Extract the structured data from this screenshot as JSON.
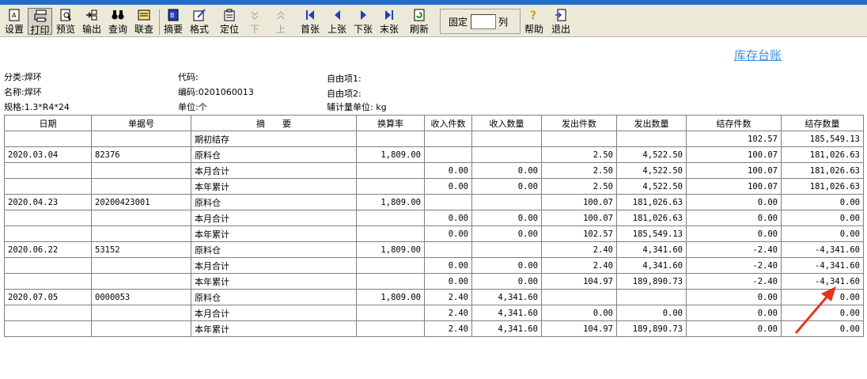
{
  "toolbar": {
    "buttons": [
      {
        "label": "设置",
        "icon": "settings-icon"
      },
      {
        "label": "打印",
        "icon": "printer-icon"
      },
      {
        "label": "预览",
        "icon": "preview-icon"
      },
      {
        "label": "输出",
        "icon": "export-icon"
      },
      {
        "label": "查询",
        "icon": "binoculars-icon"
      },
      {
        "label": "联查",
        "icon": "linked-query-icon"
      },
      {
        "label": "摘要",
        "icon": "summary-icon"
      },
      {
        "label": "格式",
        "icon": "format-icon"
      },
      {
        "label": "定位",
        "icon": "locate-icon"
      },
      {
        "label": "下",
        "icon": "down-icon"
      },
      {
        "label": "上",
        "icon": "up-icon"
      },
      {
        "label": "首张",
        "icon": "first-page-icon"
      },
      {
        "label": "上张",
        "icon": "prev-page-icon"
      },
      {
        "label": "下张",
        "icon": "next-page-icon"
      },
      {
        "label": "末张",
        "icon": "last-page-icon"
      },
      {
        "label": "刷新",
        "icon": "refresh-icon"
      },
      {
        "label": "帮助",
        "icon": "help-icon"
      },
      {
        "label": "退出",
        "icon": "exit-icon"
      }
    ],
    "fix_label": "固定",
    "fix_value": "",
    "col_label": "列"
  },
  "report": {
    "title": "库存台账",
    "category": "分类:焊环",
    "name": "名称:焊环",
    "spec": "规格:1.3*R4*24",
    "code": "代码:",
    "number": "编码:0201060013",
    "unit": "单位:个",
    "free1": "自由项1:",
    "free2": "自由项2:",
    "aux_unit": "辅计量单位: kg"
  },
  "table": {
    "headers": [
      "日期",
      "单据号",
      "摘　　要",
      "换算率",
      "收入件数",
      "收入数量",
      "发出件数",
      "发出数量",
      "结存件数",
      "结存数量"
    ],
    "rows": [
      [
        "",
        "",
        "期初结存",
        "",
        "",
        "",
        "",
        "",
        "102.57",
        "185,549.13"
      ],
      [
        "2020.03.04",
        "82376",
        "原料仓",
        "1,809.00",
        "",
        "",
        "2.50",
        "4,522.50",
        "100.07",
        "181,026.63"
      ],
      [
        "",
        "",
        "本月合计",
        "",
        "0.00",
        "0.00",
        "2.50",
        "4,522.50",
        "100.07",
        "181,026.63"
      ],
      [
        "",
        "",
        "本年累计",
        "",
        "0.00",
        "0.00",
        "2.50",
        "4,522.50",
        "100.07",
        "181,026.63"
      ],
      [
        "2020.04.23",
        "20200423001",
        "原料仓",
        "1,809.00",
        "",
        "",
        "100.07",
        "181,026.63",
        "0.00",
        "0.00"
      ],
      [
        "",
        "",
        "本月合计",
        "",
        "0.00",
        "0.00",
        "100.07",
        "181,026.63",
        "0.00",
        "0.00"
      ],
      [
        "",
        "",
        "本年累计",
        "",
        "0.00",
        "0.00",
        "102.57",
        "185,549.13",
        "0.00",
        "0.00"
      ],
      [
        "2020.06.22",
        "53152",
        "原料仓",
        "1,809.00",
        "",
        "",
        "2.40",
        "4,341.60",
        "-2.40",
        "-4,341.60"
      ],
      [
        "",
        "",
        "本月合计",
        "",
        "0.00",
        "0.00",
        "2.40",
        "4,341.60",
        "-2.40",
        "-4,341.60"
      ],
      [
        "",
        "",
        "本年累计",
        "",
        "0.00",
        "0.00",
        "104.97",
        "189,890.73",
        "-2.40",
        "-4,341.60"
      ],
      [
        "2020.07.05",
        "0000053",
        "原料仓",
        "1,809.00",
        "2.40",
        "4,341.60",
        "",
        "",
        "0.00",
        "0.00"
      ],
      [
        "",
        "",
        "本月合计",
        "",
        "2.40",
        "4,341.60",
        "0.00",
        "0.00",
        "0.00",
        "0.00"
      ],
      [
        "",
        "",
        "本年累计",
        "",
        "2.40",
        "4,341.60",
        "104.97",
        "189,890.73",
        "0.00",
        "0.00"
      ]
    ]
  },
  "colors": {
    "accent": "#3b8ee8",
    "annotation_arrow": "#e8341c",
    "toolbar_bg": "#ece9d8"
  }
}
